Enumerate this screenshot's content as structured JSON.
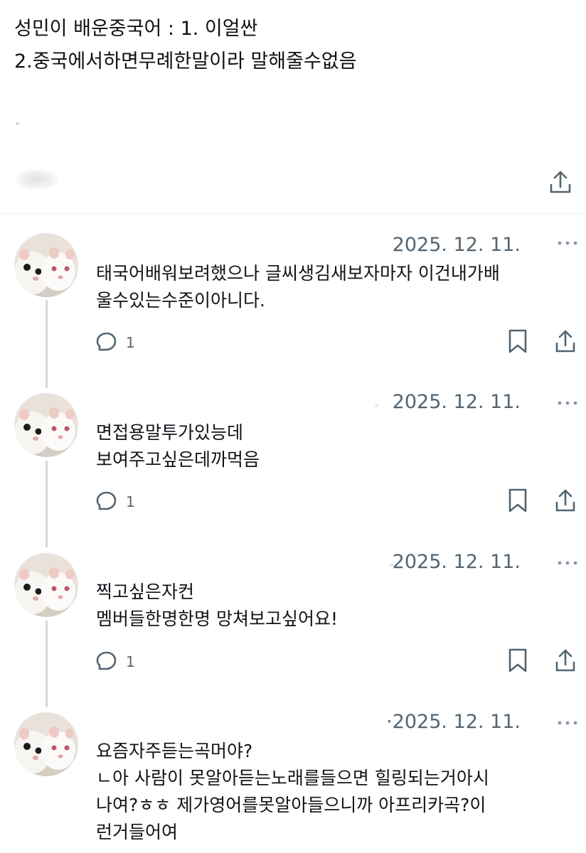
{
  "post": {
    "lines": [
      "성민이 배운중국어 : 1. 이얼싼",
      "2.중국에서하면무례한말이라 말해줄수없음"
    ],
    "share_icon": "share-icon"
  },
  "replies": [
    {
      "date": "2025. 12. 11.",
      "date_lead": "",
      "lines": [
        "태국어배워보려했으나 글씨생김새보자마자 이건내가배",
        "울수있는수준이아니다."
      ],
      "reply_count": "1"
    },
    {
      "date": "2025. 12. 11.",
      "date_lead": "",
      "lines": [
        "면접용말투가있능데",
        "보여주고싶은데까먹음"
      ],
      "reply_count": "1"
    },
    {
      "date": "2025. 12. 11.",
      "date_lead": "",
      "lines": [
        "찍고싶은자컨",
        "멤버들한명한명 망쳐보고싶어요!"
      ],
      "reply_count": "1"
    },
    {
      "date": "2025. 12. 11.",
      "date_lead": "·",
      "lines": [
        "요즘자주듣는곡머야?",
        "ㄴ아 사람이 못알아듣는노래를들으면 힐링되는거아시",
        "나여?ㅎㅎ 제가영어를못알아들으니까 아프리카곡?이",
        "런거들어여"
      ],
      "reply_count": "1"
    }
  ],
  "icons": {
    "reply": "reply-icon",
    "bookmark": "bookmark-icon",
    "share": "share-icon",
    "more": "more-dots-icon",
    "avatar": "hamster-avatar"
  },
  "colors": {
    "text": "#0f1419",
    "secondary": "#536471",
    "divider": "#eff3f4",
    "thread_line": "#cfd9de"
  }
}
